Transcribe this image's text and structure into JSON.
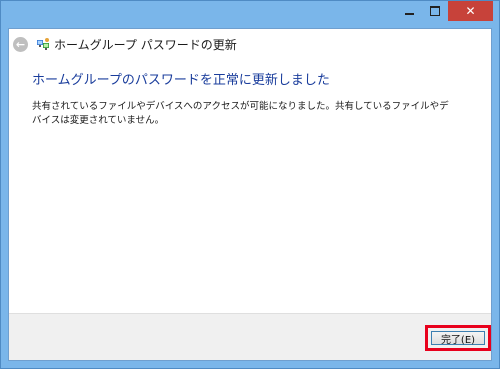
{
  "window": {
    "title": "ホームグループ パスワードの更新",
    "controls": {
      "minimize_icon": "minimize-icon",
      "maximize_icon": "maximize-icon",
      "close_icon": "close-icon",
      "close_glyph": "✕"
    }
  },
  "nav": {
    "back_icon": "back-arrow-icon",
    "back_glyph": "←",
    "app_icon": "homegroup-icon"
  },
  "main": {
    "heading": "ホームグループのパスワードを正常に更新しました",
    "message": "共有されているファイルやデバイスへのアクセスが可能になりました。共有しているファイルやデバイスは変更されていません。"
  },
  "footer": {
    "finish_label": "完了(E)"
  },
  "colors": {
    "frame": "#7ab6ea",
    "close_button": "#c7423a",
    "heading": "#1a3d9c",
    "highlight": "#e8001c"
  }
}
